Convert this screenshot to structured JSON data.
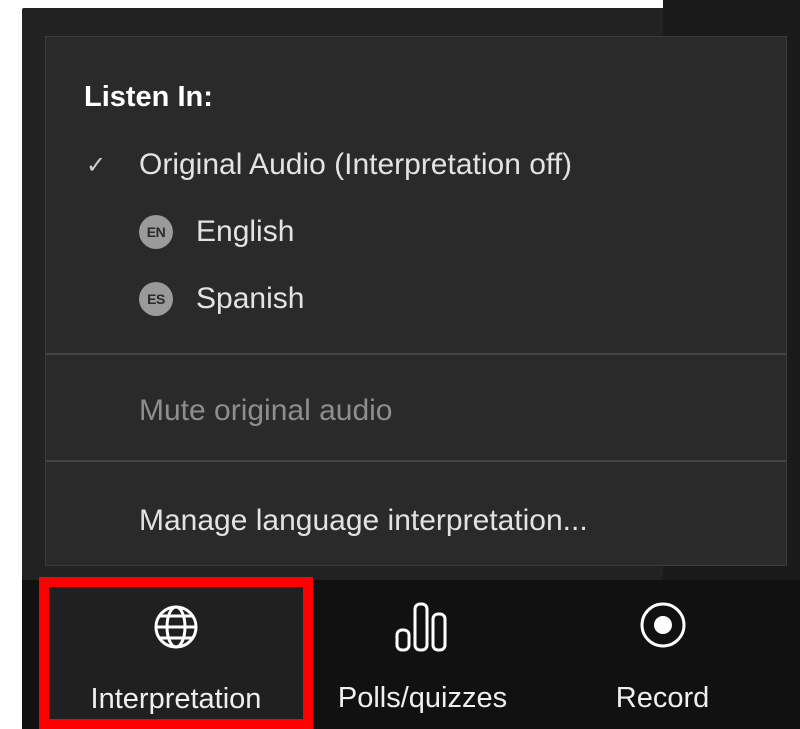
{
  "menu": {
    "title": "Listen In:",
    "items": [
      {
        "label": "Original Audio (Interpretation off)",
        "checked": true
      },
      {
        "label": "English",
        "badge": "EN"
      },
      {
        "label": "Spanish",
        "badge": "ES"
      }
    ],
    "mute_label": "Mute original audio",
    "manage_label": "Manage language interpretation..."
  },
  "toolbar": {
    "interpretation_label": "Interpretation",
    "polls_label": "Polls/quizzes",
    "record_label": "Record"
  },
  "colors": {
    "highlight": "#ff0000",
    "menu_bg": "#2a2a2a",
    "toolbar_bg": "#111111"
  },
  "icons": {
    "check": "check-icon",
    "interpretation": "globe-icon",
    "polls": "bar-chart-icon",
    "record": "record-icon"
  }
}
